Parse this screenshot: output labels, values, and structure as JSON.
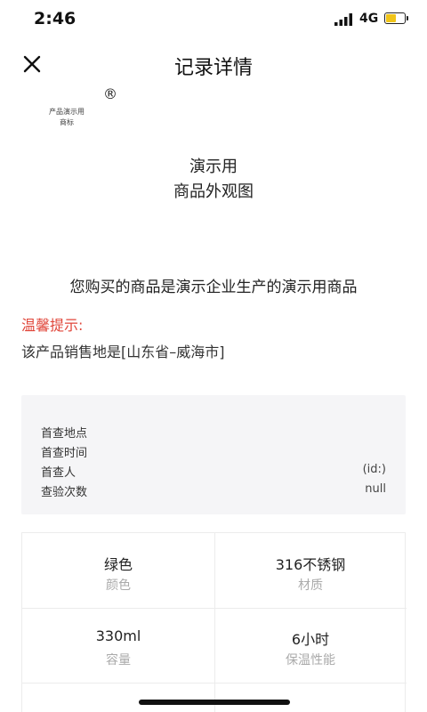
{
  "status_bar": {
    "time": "2:46",
    "network": "4G",
    "battery_level": 0.6
  },
  "nav": {
    "title": "记录详情"
  },
  "logo": {
    "registered_mark": "®",
    "line1": "产品演示用",
    "line2": "商标"
  },
  "product_image": {
    "line1": "演示用",
    "line2": "商品外观图"
  },
  "purchase_message": "您购买的商品是演示企业生产的演示用商品",
  "tip": {
    "title": "温馨提示:",
    "text": "该产品销售地是[山东省–威海市]"
  },
  "query_info": [
    {
      "label": "首查地点",
      "value": ""
    },
    {
      "label": "首查时间",
      "value": ""
    },
    {
      "label": "首查人",
      "value": "(id:)"
    },
    {
      "label": "查验次数",
      "value": "null"
    }
  ],
  "specs": [
    {
      "value": "绿色",
      "label": "颜色"
    },
    {
      "value": "316不锈钢",
      "label": "材质"
    },
    {
      "value": "330ml",
      "label": "容量"
    },
    {
      "value": "6小时",
      "label": "保温性能"
    }
  ],
  "colors": {
    "tip_red": "#e0463a",
    "panel_bg": "#f5f5f7",
    "battery_yellow": "#f0c419"
  }
}
